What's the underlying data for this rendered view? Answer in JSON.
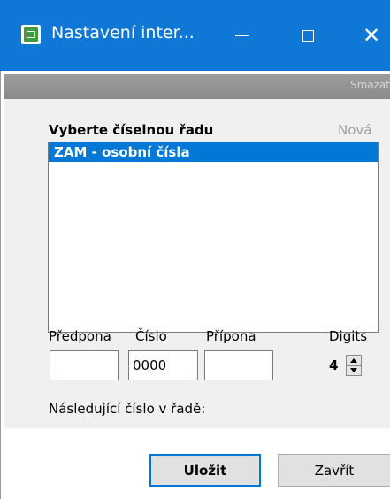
{
  "window": {
    "title": "Nastavení inter...",
    "icon": "app-green-icon",
    "controls": {
      "minimize": "—",
      "maximize": "□",
      "close": "✕"
    }
  },
  "toolbar": {
    "delete_label": "Smazat"
  },
  "series": {
    "section_label": "Vyberte číselnou řadu",
    "new_label": "Nová",
    "items": [
      {
        "label": "ZAM - osobní čísla",
        "selected": true
      }
    ]
  },
  "fields": {
    "prefix_label": "Předpona",
    "number_label": "Číslo",
    "suffix_label": "Přípona",
    "digits_label": "Digits",
    "prefix_value": "",
    "number_value": "0000",
    "suffix_value": "",
    "digits_value": "4"
  },
  "next_label": "Následující číslo v řadě:",
  "buttons": {
    "save": "Uložit",
    "close": "Zavřít"
  },
  "colors": {
    "titlebar": "#0f78d7",
    "selection": "#0078d7"
  }
}
